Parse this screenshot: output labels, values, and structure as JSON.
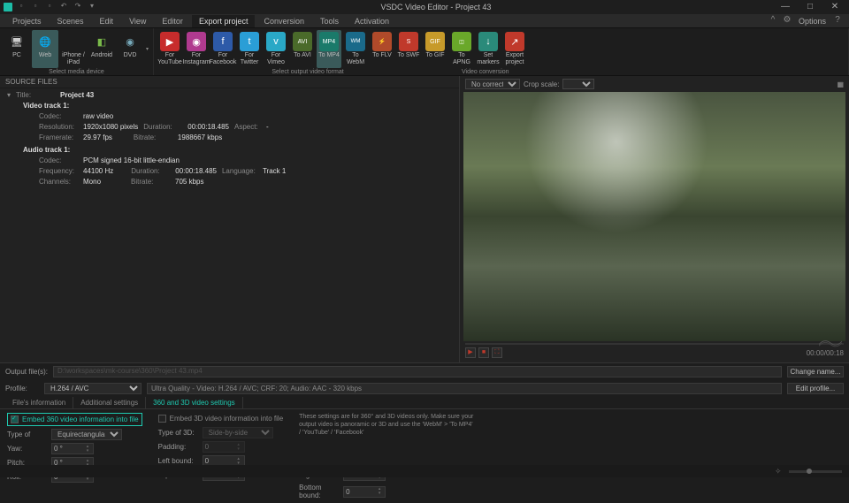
{
  "titlebar": {
    "app_title": "VSDC Video Editor - Project 43"
  },
  "menubar": {
    "items": [
      "Projects",
      "Scenes",
      "Edit",
      "View",
      "Editor",
      "Export project",
      "Conversion",
      "Tools",
      "Activation"
    ],
    "options_label": "Options"
  },
  "ribbon": {
    "media_group_caption": "Select media device",
    "media_items": [
      {
        "label": "PC",
        "color": "#333"
      },
      {
        "label": "Web",
        "color": "#1cbca6"
      },
      {
        "label": "iPhone / iPad",
        "color": "#444"
      },
      {
        "label": "Android",
        "color": "#444"
      },
      {
        "label": "DVD",
        "color": "#3a5a8a"
      }
    ],
    "conv_group_caption": "Video conversion",
    "format_group_caption": "Select output video format",
    "conv_items": [
      {
        "label": "For YouTube",
        "color": "#c72c2c"
      },
      {
        "label": "For Instagram",
        "color": "#b03a8f"
      },
      {
        "label": "For Facebook",
        "color": "#2d5aa8"
      },
      {
        "label": "For Twitter",
        "color": "#2a9ed6"
      },
      {
        "label": "For Vimeo",
        "color": "#2aa8c6"
      },
      {
        "label": "To AVI",
        "color": "#4a6a2a"
      },
      {
        "label": "To MP4",
        "color": "#1a7a6a"
      },
      {
        "label": "To WebM",
        "color": "#1a6a8a"
      },
      {
        "label": "To FLV",
        "color": "#b04a2a"
      },
      {
        "label": "To SWF",
        "color": "#c0392b"
      },
      {
        "label": "To GIF",
        "color": "#c79a2a"
      },
      {
        "label": "To APNG",
        "color": "#6aa82a"
      },
      {
        "label": "Set markers",
        "color": "#2a8a7a"
      },
      {
        "label": "Export project",
        "color": "#c0392b"
      }
    ]
  },
  "source_files": {
    "header": "SOURCE FILES",
    "title_label": "Title:",
    "title_value": "Project 43",
    "video_track_header": "Video track 1:",
    "video": {
      "codec_label": "Codec:",
      "codec": "raw video",
      "resolution_label": "Resolution:",
      "resolution": "1920x1080 pixels",
      "duration_label": "Duration:",
      "duration": "00:00:18.485",
      "aspect_label": "Aspect:",
      "aspect": "-",
      "framerate_label": "Framerate:",
      "framerate": "29.97 fps",
      "bitrate_label": "Bitrate:",
      "bitrate": "1988667 kbps"
    },
    "audio_track_header": "Audio track 1:",
    "audio": {
      "codec_label": "Codec:",
      "codec": "PCM signed 16-bit little-endian",
      "frequency_label": "Frequency:",
      "frequency": "44100 Hz",
      "duration_label": "Duration:",
      "duration": "00:00:18.485",
      "language_label": "Language:",
      "language": "Track 1",
      "channels_label": "Channels:",
      "channels": "Mono",
      "bitrate_label": "Bitrate:",
      "bitrate": "705 kbps"
    }
  },
  "preview": {
    "correction_label": "No correction",
    "crop_label": "Crop scale:",
    "time": "00:00/00:18"
  },
  "output": {
    "file_label": "Output file(s):",
    "file_placeholder": "D:\\workspaces\\mk-course\\360\\Project 43.mp4",
    "change_name": "Change name...",
    "profile_label": "Profile:",
    "profile_value": "H.264 / AVC",
    "profile_desc": "Ultra Quality - Video: H.264 / AVC; CRF: 20; Audio: AAC - 320 kbps",
    "edit_profile": "Edit profile..."
  },
  "tabs": {
    "items": [
      "File's information",
      "Additional settings",
      "360 and 3D video settings"
    ]
  },
  "settings": {
    "embed360_label": "Embed 360 video information into file",
    "embed3d_label": "Embed 3D video information into file",
    "type_of_label": "Type of",
    "type_of_value": "Equirectangular",
    "yaw_label": "Yaw:",
    "yaw_value": "0 °",
    "pitch_label": "Pitch:",
    "pitch_value": "0 °",
    "roll_label": "Roll:",
    "roll_value": "0 °",
    "type3d_label": "Type of 3D:",
    "type3d_value": "Side-by-side",
    "padding_label": "Padding:",
    "padding_value": "0",
    "left_label": "Left bound:",
    "left_value": "0",
    "top_label": "Top bound:",
    "top_value": "0",
    "right_label": "Right bound:",
    "right_value": "0",
    "bottom_label": "Bottom bound:",
    "bottom_value": "0",
    "description": "These settings are for 360° and 3D videos only. Make sure your output video is panoramic or 3D and use the 'WebM' > 'To MP4' / 'YouTube' / 'Facebook'"
  }
}
